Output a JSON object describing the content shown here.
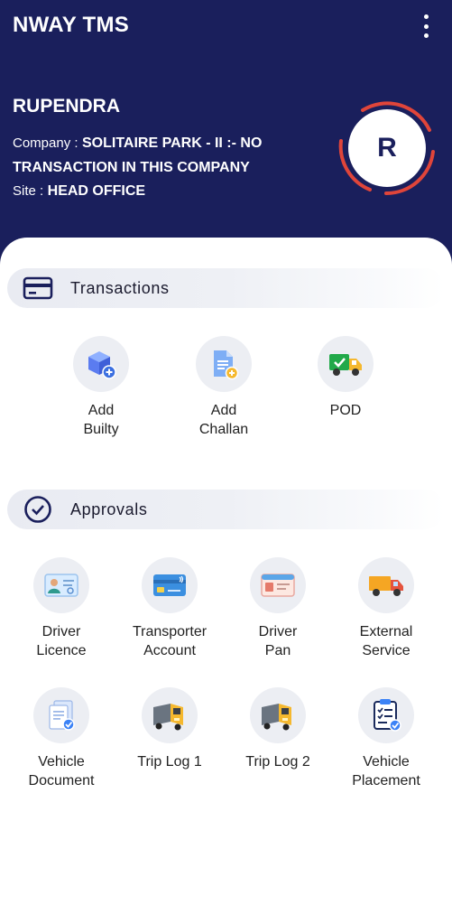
{
  "app": {
    "title": "NWAY TMS"
  },
  "user": {
    "name": "RUPENDRA",
    "company_label": "Company :",
    "company_value": "SOLITAIRE PARK - II :- NO TRANSACTION IN THIS COMPANY",
    "site_label": "Site :",
    "site_value": "HEAD OFFICE",
    "avatar_initial": "R"
  },
  "colors": {
    "header_bg": "#1a1f5c",
    "ring": "#e0453a",
    "icon_blue": "#3b82f6",
    "icon_yellow": "#f5b82e",
    "icon_green": "#22a94a"
  },
  "sections": {
    "transactions": {
      "title": "Transactions",
      "icon": "card-icon",
      "items": [
        {
          "label": "Add\nBuilty",
          "icon": "cube-plus-icon"
        },
        {
          "label": "Add\nChallan",
          "icon": "document-plus-icon"
        },
        {
          "label": "POD",
          "icon": "delivery-truck-icon"
        }
      ]
    },
    "approvals": {
      "title": "Approvals",
      "icon": "check-circle-icon",
      "items": [
        {
          "label": "Driver\nLicence",
          "icon": "id-card-icon"
        },
        {
          "label": "Transporter\nAccount",
          "icon": "credit-card-icon"
        },
        {
          "label": "Driver\nPan",
          "icon": "pan-card-icon"
        },
        {
          "label": "External\nService",
          "icon": "truck-icon"
        },
        {
          "label": "Vehicle\nDocument",
          "icon": "documents-check-icon"
        },
        {
          "label": "Trip Log 1",
          "icon": "truck-front-icon"
        },
        {
          "label": "Trip Log 2",
          "icon": "truck-front-icon"
        },
        {
          "label": "Vehicle\nPlacement",
          "icon": "clipboard-check-icon"
        }
      ]
    }
  }
}
